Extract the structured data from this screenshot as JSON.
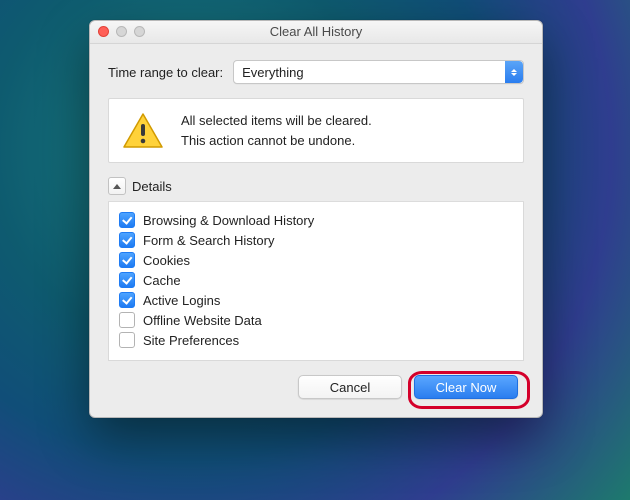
{
  "window": {
    "title": "Clear All History"
  },
  "range": {
    "label": "Time range to clear:",
    "selected": "Everything"
  },
  "warning": {
    "line1": "All selected items will be cleared.",
    "line2": "This action cannot be undone."
  },
  "details": {
    "label": "Details",
    "items": [
      {
        "label": "Browsing & Download History",
        "checked": true
      },
      {
        "label": "Form & Search History",
        "checked": true
      },
      {
        "label": "Cookies",
        "checked": true
      },
      {
        "label": "Cache",
        "checked": true
      },
      {
        "label": "Active Logins",
        "checked": true
      },
      {
        "label": "Offline Website Data",
        "checked": false
      },
      {
        "label": "Site Preferences",
        "checked": false
      }
    ]
  },
  "buttons": {
    "cancel": "Cancel",
    "clear": "Clear Now"
  },
  "colors": {
    "accent": "#2a7def",
    "highlight": "#d4002a"
  }
}
